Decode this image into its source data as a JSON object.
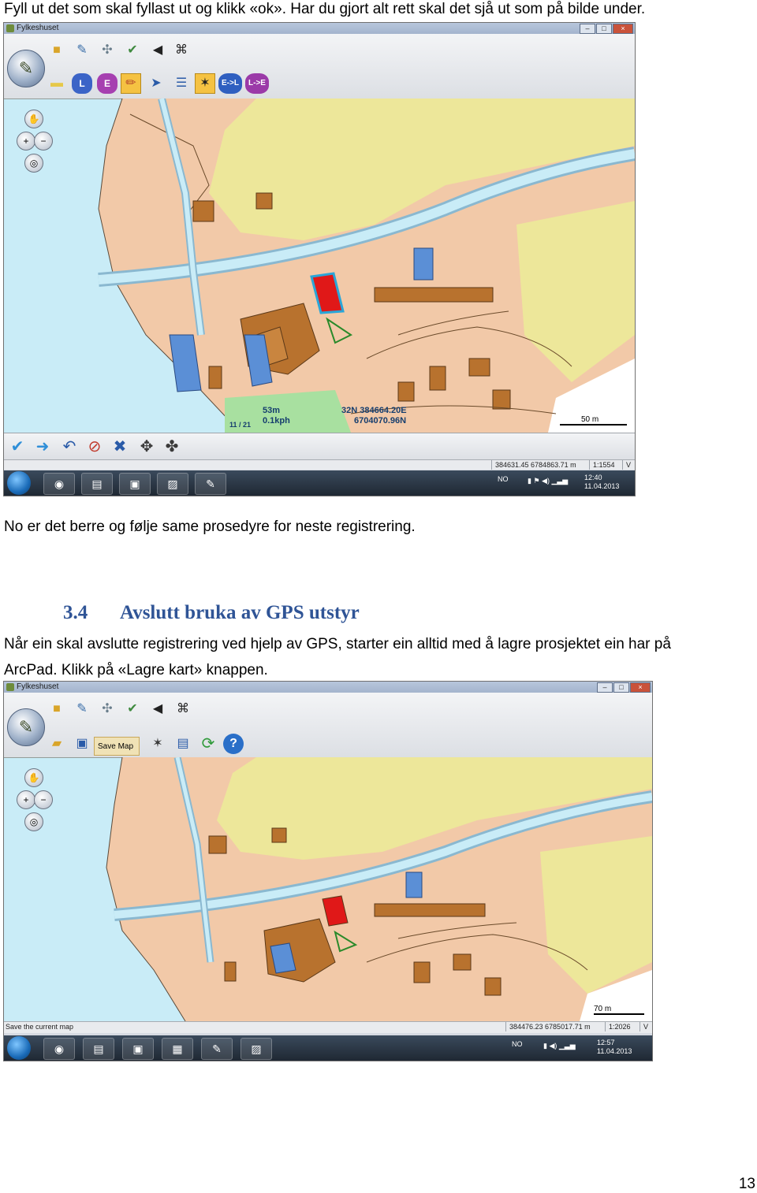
{
  "intro_text": "Fyll ut det som skal fyllast ut og klikk «ok». Har du gjort alt rett skal det sjå ut som på bilde under.",
  "after_shot_text": "No er det berre og følje same prosedyre for neste registrering.",
  "section": {
    "number": "3.4",
    "title": "Avslutt bruka av GPS utstyr"
  },
  "section_body_line1": "Når ein skal avslutte registrering ved hjelp av GPS, starter ein alltid med å lagre prosjektet ein har på",
  "section_body_line2": "ArcPad. Klikk på «Lagre kart» knappen.",
  "page_number": "13",
  "screenshot1": {
    "window_title": "Fylkeshuset",
    "toolbar_labels": {
      "l": "L",
      "e": "E",
      "el": "E->L",
      "le": "L->E"
    },
    "gps": {
      "altitude": "53m",
      "speed": "0.1kph",
      "satellites": "11 / 21",
      "coord_e": "32N  384664.20E",
      "coord_n": "6704070.96N"
    },
    "scale_label": "50 m",
    "status_coords": "384631.45 6784863.71 m",
    "status_scale": "1:1554",
    "status_end": "V",
    "tray": {
      "lang": "NO",
      "time": "12:40",
      "date": "11.04.2013"
    }
  },
  "screenshot2": {
    "window_title": "Fylkeshuset",
    "save_map_label": "Save Map",
    "scale_label": "70 m",
    "status_hint": "Save the current map",
    "status_coords": "384476.23 6785017.71 m",
    "status_scale": "1:2026",
    "status_end": "V",
    "tray": {
      "lang": "NO",
      "time": "12:57",
      "date": "11.04.2013"
    }
  },
  "colors": {
    "heading": "#2f5496",
    "map_background": "#f2c9a8",
    "water": "#c9ecf7",
    "field": "#ede79a",
    "building": "#b8722e",
    "building_blue": "#5b8fd6",
    "selected_feature": "#e01818",
    "gps_zone": "#a8e0a0"
  }
}
